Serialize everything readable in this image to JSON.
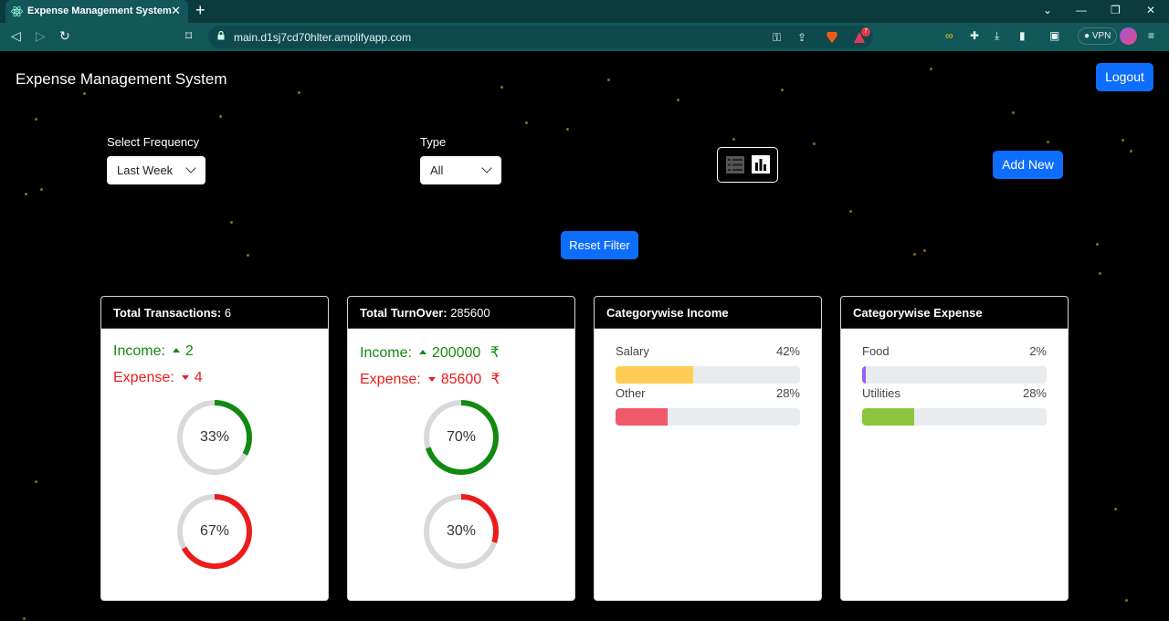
{
  "browser": {
    "tab_title": "Expense Management System",
    "tab_close": "✕",
    "new_tab": "+",
    "url": "main.d1sj7cd70hlter.amplifyapp.com",
    "vpn_label": "VPN",
    "brave_badge": "7",
    "window_controls": [
      "⌄",
      "—",
      "❐",
      "✕"
    ]
  },
  "app": {
    "title": "Expense Management System",
    "logout_label": "Logout"
  },
  "filters": {
    "frequency_label": "Select Frequency",
    "frequency_value": "Last Week",
    "type_label": "Type",
    "type_value": "All",
    "add_new_label": "Add New",
    "reset_label": "Reset Filter"
  },
  "transactions_card": {
    "title": "Total Transactions:",
    "total": "6",
    "income_label": "Income:",
    "income_count": "2",
    "expense_label": "Expense:",
    "expense_count": "4",
    "income_percent_label": "33%",
    "income_percent": 33,
    "expense_percent_label": "67%",
    "expense_percent": 67
  },
  "turnover_card": {
    "title": "Total TurnOver:",
    "total": "285600",
    "income_label": "Income:",
    "income_amount": "200000",
    "expense_label": "Expense:",
    "expense_amount": "85600",
    "currency": "₹",
    "income_percent_label": "70%",
    "income_percent": 70,
    "expense_percent_label": "30%",
    "expense_percent": 30
  },
  "income_category_card": {
    "title": "Categorywise Income",
    "items": [
      {
        "name": "Salary",
        "percent_label": "42%",
        "percent": 42,
        "color": "#ffcd56"
      },
      {
        "name": "Other",
        "percent_label": "28%",
        "percent": 28,
        "color": "#ef5a6a"
      }
    ]
  },
  "expense_category_card": {
    "title": "Categorywise Expense",
    "items": [
      {
        "name": "Food",
        "percent_label": "2%",
        "percent": 2,
        "color": "#9b5cf6"
      },
      {
        "name": "Utilities",
        "percent_label": "28%",
        "percent": 28,
        "color": "#8cc63f"
      }
    ]
  },
  "colors": {
    "income": "#118a11",
    "expense": "#ec1c1c",
    "primary": "#0d6efd",
    "ring_track": "#d9d9d9"
  }
}
